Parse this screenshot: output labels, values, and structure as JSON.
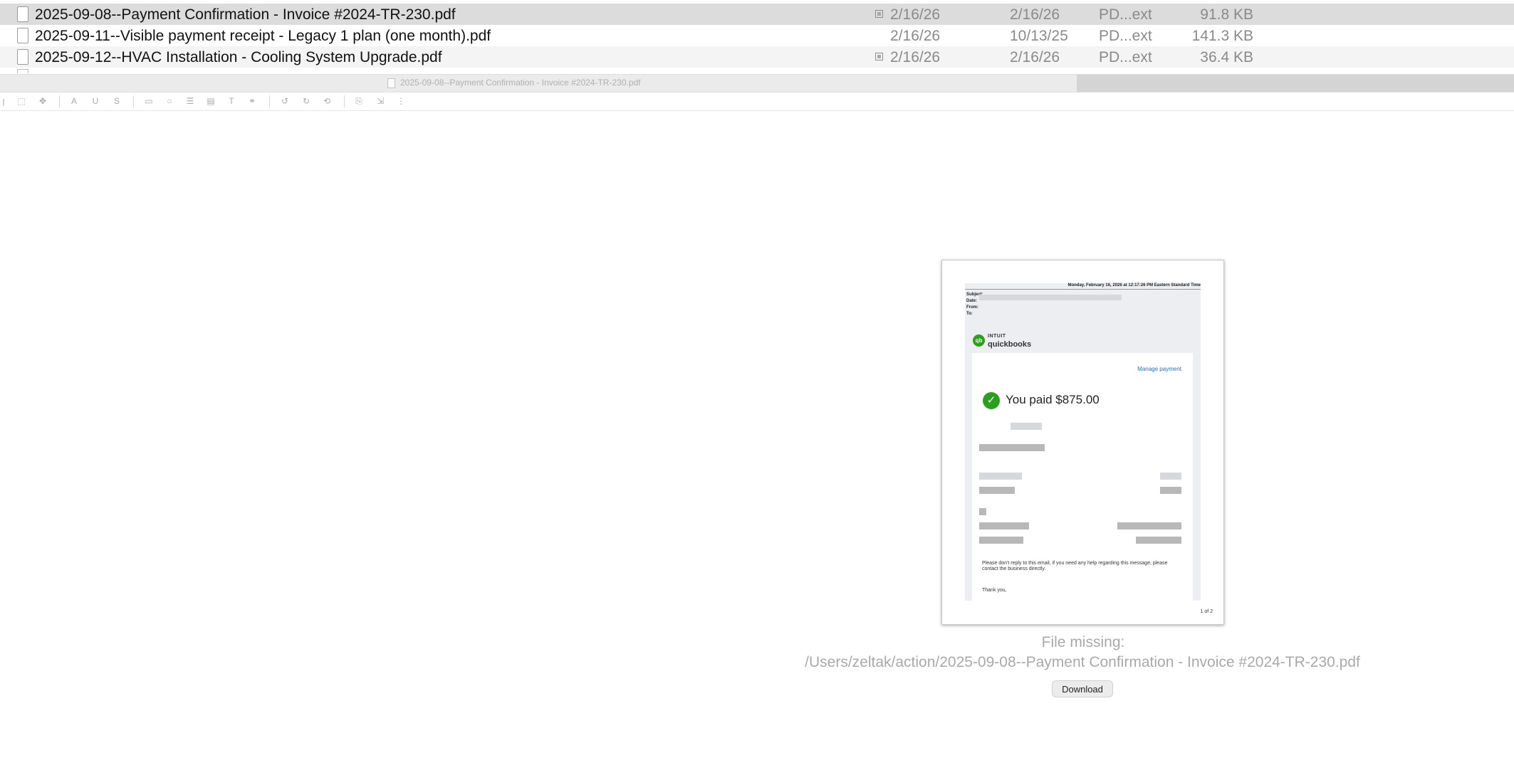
{
  "file_list": {
    "rows": [
      {
        "name": "2025-09-08--Payment Confirmation - Invoice #2024-TR-230.pdf",
        "created": "2/16/26",
        "modified": "2/16/26",
        "kind": "PD...ext",
        "size": "91.8 KB"
      },
      {
        "name": "2025-09-11--Visible payment receipt - Legacy 1 plan (one month).pdf",
        "created": "2/16/26",
        "modified": "10/13/25",
        "kind": "PD...ext",
        "size": "141.3 KB"
      },
      {
        "name": "2025-09-12--HVAC Installation - Cooling System Upgrade.pdf",
        "created": "2/16/26",
        "modified": "2/16/26",
        "kind": "PD...ext",
        "size": "36.4 KB"
      }
    ]
  },
  "viewer": {
    "title": "2025-09-08--Payment Confirmation - Invoice #2024-TR-230.pdf"
  },
  "toolbar": {
    "icons": [
      "text-select-icon",
      "rect-select-icon",
      "move-icon",
      "highlight-icon",
      "underline-icon",
      "strikethrough-icon",
      "rectangle-icon",
      "circle-icon",
      "line-icon",
      "note-icon",
      "textbox-icon",
      "link-icon",
      "rotate-left-icon",
      "rotate-right-icon",
      "flip-icon",
      "insert-page-icon",
      "extract-page-icon",
      "split-icon"
    ]
  },
  "preview": {
    "email_date": "Monday, February 16, 2026 at 12:17:26 PM Eastern Standard Time",
    "meta_labels": [
      "Subject:",
      "Date:",
      "From:",
      "To:"
    ],
    "brand_top": "INTUIT",
    "brand_name": "quickbooks",
    "manage_link": "Manage payment",
    "paid_text": "You paid $875.00",
    "notice": "Please don't reply to this email, if you need any help regarding this message, please contact the business directly.",
    "thanks": "Thank you,",
    "page_count": "1 of 2"
  },
  "status": {
    "missing_label": "File missing:",
    "missing_path": "/Users/zeltak/action/2025-09-08--Payment Confirmation - Invoice #2024-TR-230.pdf",
    "download_label": "Download"
  }
}
